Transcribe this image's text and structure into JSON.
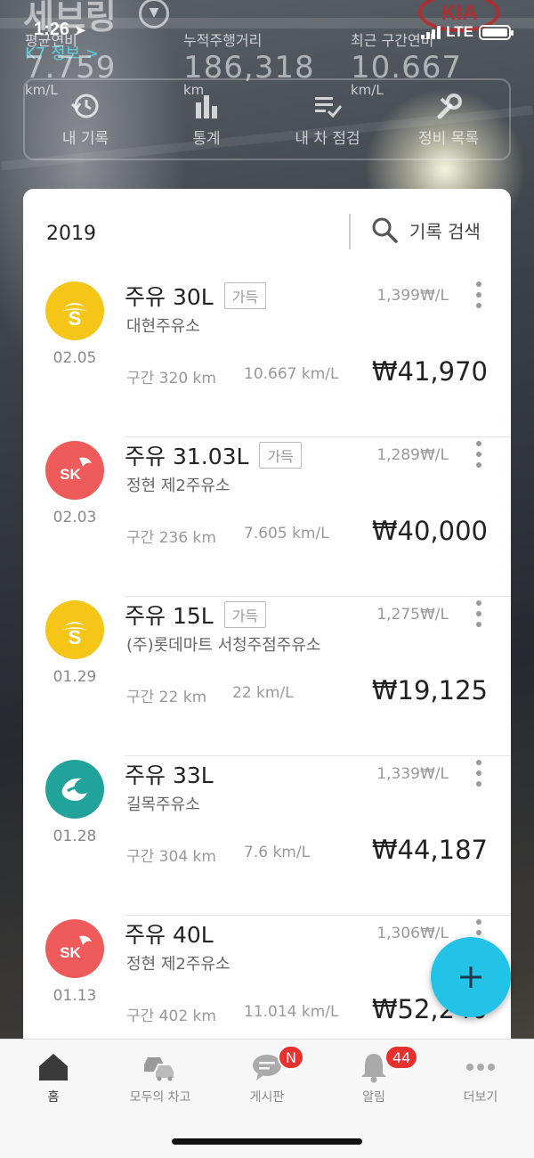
{
  "status_bar": {
    "time": "1:26",
    "network": "LTE"
  },
  "header": {
    "car_name": "세브링",
    "car_model": "K7 정보 >",
    "stats": [
      {
        "label": "평균연비",
        "value": "7.759",
        "unit": "km/L"
      },
      {
        "label": "누적주행거리",
        "value": "186,318",
        "unit": "km"
      },
      {
        "label": "최근 구간연비",
        "value": "10.667",
        "unit": "km/L"
      }
    ],
    "menu": [
      {
        "label": "내 기록",
        "icon": "history-icon"
      },
      {
        "label": "통계",
        "icon": "bar-chart-icon"
      },
      {
        "label": "내 차 점검",
        "icon": "checklist-icon"
      },
      {
        "label": "정비 목록",
        "icon": "wrench-icon"
      }
    ]
  },
  "records_card": {
    "year": "2019",
    "search_label": "기록 검색",
    "records": [
      {
        "brand": "S-OIL",
        "brand_text": "S",
        "brand_color": "#f5c518",
        "date": "02.05",
        "title": "주유 30L",
        "full_tag": "가득",
        "station": "대현주유소",
        "unit_price": "1,399₩/L",
        "segment": "구간 320 km",
        "efficiency": "10.667 km/L",
        "amount": "₩41,970"
      },
      {
        "brand": "SK",
        "brand_text": "SK",
        "brand_color": "#ef5b5b",
        "date": "02.03",
        "title": "주유 31.03L",
        "full_tag": "가득",
        "station": "정현 제2주유소",
        "unit_price": "1,289₩/L",
        "segment": "구간 236 km",
        "efficiency": "7.605 km/L",
        "amount": "₩40,000"
      },
      {
        "brand": "S-OIL",
        "brand_text": "S",
        "brand_color": "#f5c518",
        "date": "01.29",
        "title": "주유 15L",
        "full_tag": "가득",
        "station": "(주)롯데마트 서청주점주유소",
        "unit_price": "1,275₩/L",
        "segment": "구간 22 km",
        "efficiency": "22 km/L",
        "amount": "₩19,125"
      },
      {
        "brand": "GS",
        "brand_text": "",
        "brand_color": "#21a39c",
        "date": "01.28",
        "title": "주유 33L",
        "full_tag": "",
        "station": "길목주유소",
        "unit_price": "1,339₩/L",
        "segment": "구간 304 km",
        "efficiency": "7.6 km/L",
        "amount": "₩44,187"
      },
      {
        "brand": "SK",
        "brand_text": "SK",
        "brand_color": "#ef5b5b",
        "date": "01.13",
        "title": "주유 40L",
        "full_tag": "",
        "station": "정현 제2주유소",
        "unit_price": "1,306₩/L",
        "segment": "구간 402 km",
        "efficiency": "11.014 km/L",
        "amount": "₩52,240"
      }
    ]
  },
  "fab": {
    "icon": "plus-icon"
  },
  "bottom_nav": [
    {
      "label": "홈",
      "icon": "home-icon",
      "badge": ""
    },
    {
      "label": "모두의 차고",
      "icon": "cars-icon",
      "badge": ""
    },
    {
      "label": "게시판",
      "icon": "chat-icon",
      "badge": "N"
    },
    {
      "label": "알림",
      "icon": "bell-icon",
      "badge": "44"
    },
    {
      "label": "더보기",
      "icon": "more-icon",
      "badge": ""
    }
  ],
  "colors": {
    "accent": "#22c3e6",
    "badge": "#e8302f",
    "link": "#5fd0e0"
  }
}
